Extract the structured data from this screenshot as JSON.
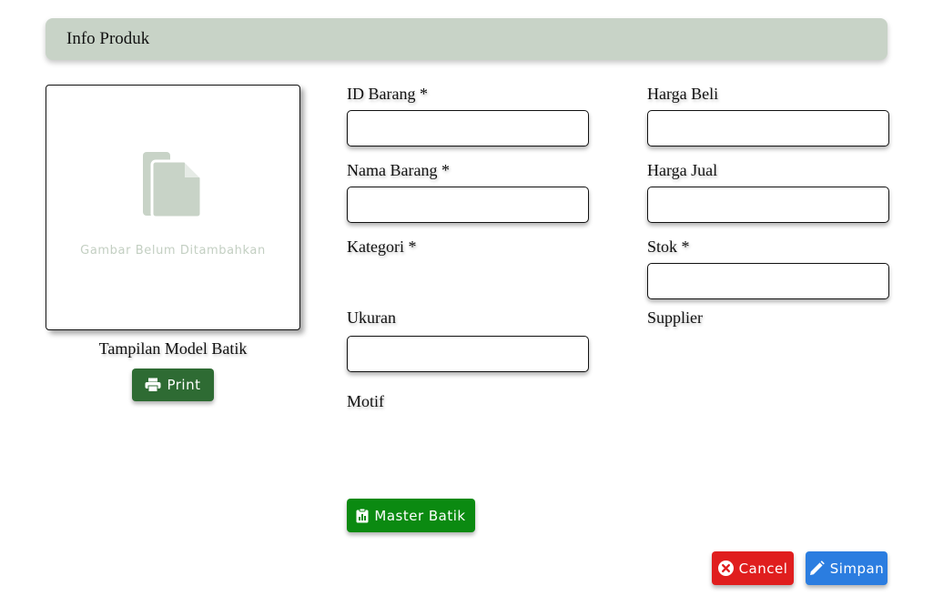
{
  "header": {
    "title": "Info Produk"
  },
  "image_panel": {
    "empty_text": "Gambar Belum Ditambahkan",
    "caption": "Tampilan Model Batik",
    "print_label": "Print",
    "icon": "file-copy-icon"
  },
  "form": {
    "id_barang": {
      "label": "ID Barang *",
      "value": ""
    },
    "nama_barang": {
      "label": "Nama Barang *",
      "value": ""
    },
    "kategori": {
      "label": "Kategori *"
    },
    "ukuran": {
      "label": "Ukuran",
      "value": ""
    },
    "motif": {
      "label": "Motif"
    },
    "harga_beli": {
      "label": "Harga Beli",
      "value": ""
    },
    "harga_jual": {
      "label": "Harga Jual",
      "value": ""
    },
    "stok": {
      "label": "Stok *",
      "value": ""
    },
    "supplier": {
      "label": "Supplier"
    }
  },
  "buttons": {
    "master_batik": "Master Batik",
    "cancel": "Cancel",
    "simpan": "Simpan"
  },
  "colors": {
    "header_bg": "#c8d3c7",
    "print_button": "#2e6b33",
    "master_button": "#0b8a11",
    "cancel_button": "#e01e1e",
    "simpan_button": "#2b7de0",
    "placeholder_icon": "#c8d3c7"
  }
}
